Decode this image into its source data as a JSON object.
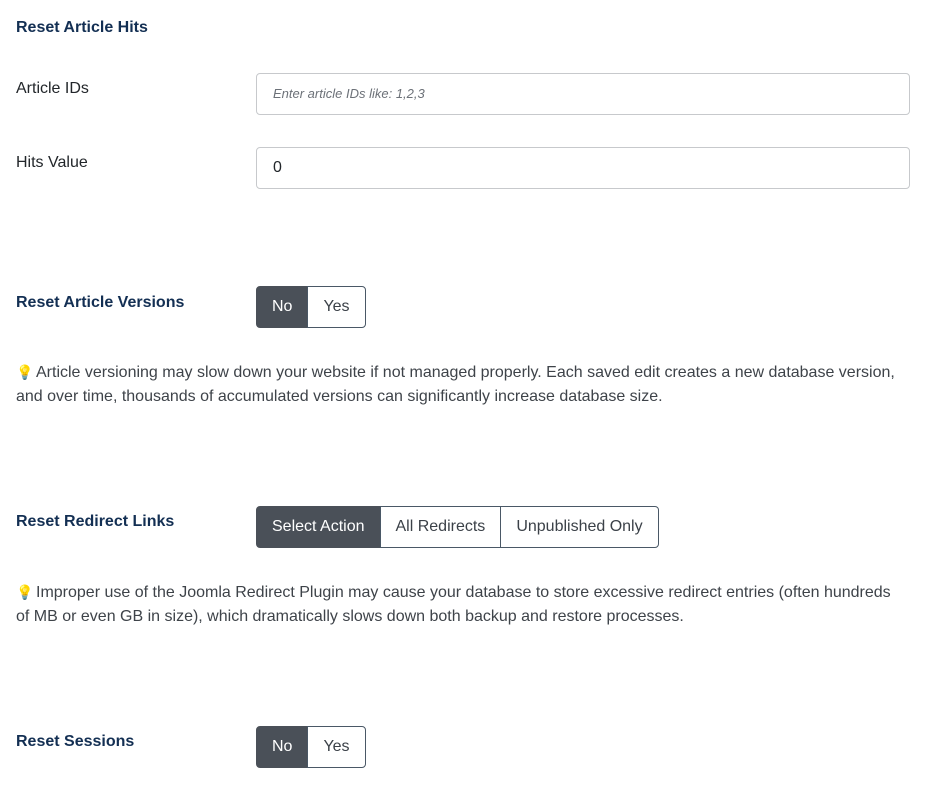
{
  "hits": {
    "heading": "Reset Article Hits",
    "article_ids_label": "Article IDs",
    "article_ids_placeholder": "Enter article IDs like: 1,2,3",
    "article_ids_value": "",
    "hits_value_label": "Hits Value",
    "hits_value": "0"
  },
  "versions": {
    "label": "Reset Article Versions",
    "options": [
      "No",
      "Yes"
    ],
    "selected": "No",
    "note_icon": "lightbulb-icon",
    "note": "Article versioning may slow down your website if not managed properly. Each saved edit creates a new database version, and over time, thousands of accumulated versions can significantly increase database size."
  },
  "redirects": {
    "label": "Reset Redirect Links",
    "options": [
      "Select Action",
      "All Redirects",
      "Unpublished Only"
    ],
    "selected": "Select Action",
    "note_icon": "lightbulb-icon",
    "note": "Improper use of the Joomla Redirect Plugin may cause your database to store excessive redirect entries (often hundreds of MB or even GB in size), which dramatically slows down both backup and restore processes."
  },
  "sessions": {
    "label": "Reset Sessions",
    "options": [
      "No",
      "Yes"
    ],
    "selected": "No"
  },
  "colors": {
    "heading": "#132f53",
    "active_button": "#4a5058",
    "button_border": "#4a5866"
  }
}
